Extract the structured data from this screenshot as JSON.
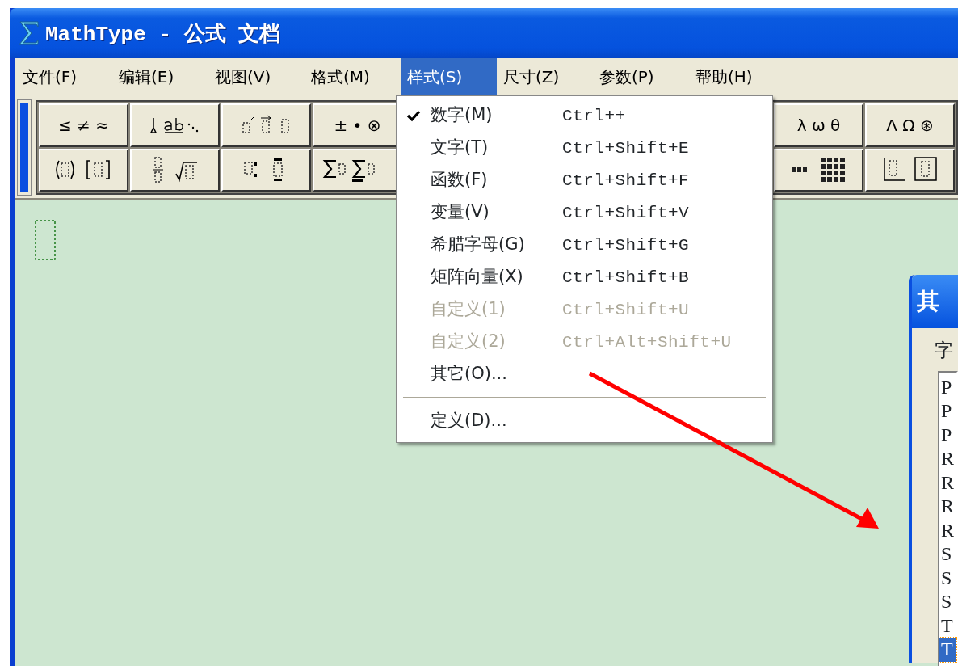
{
  "window": {
    "title": "MathType - 公式 文档"
  },
  "menubar": [
    {
      "label": "文件(F)",
      "selected": false
    },
    {
      "label": "编辑(E)",
      "selected": false
    },
    {
      "label": "视图(V)",
      "selected": false
    },
    {
      "label": "格式(M)",
      "selected": false
    },
    {
      "label": "样式(S)",
      "selected": true
    },
    {
      "label": "尺寸(Z)",
      "selected": false
    },
    {
      "label": "参数(P)",
      "selected": false
    },
    {
      "label": "帮助(H)",
      "selected": false
    }
  ],
  "toolbar": {
    "rows": [
      [
        {
          "kind": "symbols",
          "label": "≤ ≠ ≈"
        },
        {
          "kind": "embellish"
        },
        {
          "kind": "operators"
        },
        {
          "kind": "symbols",
          "label": "± • ⊗"
        },
        {
          "kind": "gap"
        },
        {
          "kind": "symbols",
          "label": "λ ω θ"
        },
        {
          "kind": "symbols",
          "label": "Λ Ω ⊛"
        }
      ],
      [
        {
          "kind": "fences"
        },
        {
          "kind": "fraction"
        },
        {
          "kind": "scripts"
        },
        {
          "kind": "sums"
        },
        {
          "kind": "gap"
        },
        {
          "kind": "matrix"
        },
        {
          "kind": "boxes"
        }
      ]
    ]
  },
  "style_menu": {
    "items": [
      {
        "kind": "item",
        "label": "数字(M)",
        "shortcut": "Ctrl++",
        "checked": true,
        "disabled": false
      },
      {
        "kind": "item",
        "label": "文字(T)",
        "shortcut": "Ctrl+Shift+E",
        "checked": false,
        "disabled": false
      },
      {
        "kind": "item",
        "label": "函数(F)",
        "shortcut": "Ctrl+Shift+F",
        "checked": false,
        "disabled": false
      },
      {
        "kind": "item",
        "label": "变量(V)",
        "shortcut": "Ctrl+Shift+V",
        "checked": false,
        "disabled": false
      },
      {
        "kind": "item",
        "label": "希腊字母(G)",
        "shortcut": "Ctrl+Shift+G",
        "checked": false,
        "disabled": false
      },
      {
        "kind": "item",
        "label": "矩阵向量(X)",
        "shortcut": "Ctrl+Shift+B",
        "checked": false,
        "disabled": false
      },
      {
        "kind": "item",
        "label": "自定义(1)",
        "shortcut": "Ctrl+Shift+U",
        "checked": false,
        "disabled": true
      },
      {
        "kind": "item",
        "label": "自定义(2)",
        "shortcut": "Ctrl+Alt+Shift+U",
        "checked": false,
        "disabled": true
      },
      {
        "kind": "item",
        "label": "其它(O)...",
        "checked": false,
        "disabled": false
      },
      {
        "kind": "separator"
      },
      {
        "kind": "item",
        "label": "定义(D)...",
        "checked": false,
        "disabled": false
      }
    ]
  },
  "dialog": {
    "title": "其",
    "label": "字",
    "list": [
      {
        "text": "P",
        "selected": false
      },
      {
        "text": "P",
        "selected": false
      },
      {
        "text": "P",
        "selected": false
      },
      {
        "text": "R",
        "selected": false
      },
      {
        "text": "R",
        "selected": false
      },
      {
        "text": "R",
        "selected": false
      },
      {
        "text": "R",
        "selected": false
      },
      {
        "text": "S",
        "selected": false
      },
      {
        "text": "S",
        "selected": false
      },
      {
        "text": "S",
        "selected": false
      },
      {
        "text": "T",
        "selected": false
      },
      {
        "text": "T",
        "selected": true
      }
    ]
  }
}
